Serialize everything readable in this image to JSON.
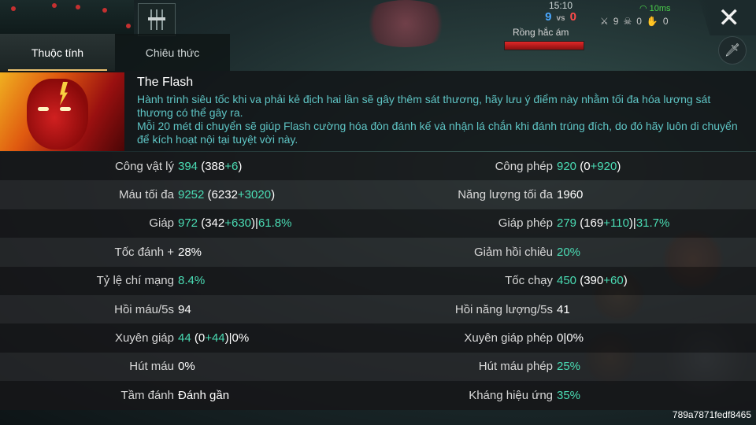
{
  "hud": {
    "time": "15:10",
    "score_blue": "9",
    "score_vs": "vs",
    "score_red": "0",
    "kills": "9",
    "deaths": "0",
    "assists": "0",
    "wifi_label": "10ms",
    "unit_label": "Rồng hắc ám",
    "close_symbol": "✕"
  },
  "tabs": [
    {
      "label": "Thuộc tính",
      "active": true
    },
    {
      "label": "Chiêu thức",
      "active": false
    }
  ],
  "hero": {
    "name": "The Flash",
    "description": [
      "Hành trình siêu tốc khi va phải kẻ địch hai lần sẽ gây thêm sát thương, hãy lưu ý điểm này nhằm tối đa hóa lượng sát thương có thể gây ra.",
      "Mỗi 20 mét di chuyển sẽ giúp Flash cường hóa đòn đánh kế và nhận lá chắn khi đánh trúng đích, do đó hãy luôn di chuyển để kích hoạt nội tại tuyệt vời này."
    ]
  },
  "stats": {
    "rows": [
      {
        "left": {
          "label": "Công vật lý",
          "value": "394",
          "detail_pre": " (388",
          "detail_bonus": "+6",
          "detail_post": ")"
        },
        "right": {
          "label": "Công phép",
          "value": "920",
          "detail_pre": " (0",
          "detail_bonus": "+920",
          "detail_post": ")"
        }
      },
      {
        "left": {
          "label": "Máu tối đa",
          "value": "9252",
          "detail_pre": " (6232",
          "detail_bonus": "+3020",
          "detail_post": ")"
        },
        "right": {
          "label": "Năng lượng tối đa",
          "value": "1960",
          "detail_pre": "",
          "detail_bonus": "",
          "detail_post": ""
        }
      },
      {
        "left": {
          "label": "Giáp",
          "value": "972",
          "detail_pre": " (342",
          "detail_bonus": "+630",
          "detail_post": ")|",
          "detail_extra": "61.8%"
        },
        "right": {
          "label": "Giáp phép",
          "value": "279",
          "detail_pre": " (169",
          "detail_bonus": "+110",
          "detail_post": ")|",
          "detail_extra": "31.7%"
        }
      },
      {
        "left": {
          "label": "Tốc đánh +",
          "value": "28%",
          "detail_pre": "",
          "detail_bonus": "",
          "detail_post": ""
        },
        "right": {
          "label": "Giảm hồi chiêu",
          "value": "20%",
          "detail_pre": "",
          "detail_bonus": "",
          "detail_post": ""
        }
      },
      {
        "left": {
          "label": "Tỷ lệ chí mạng",
          "value": "8.4%",
          "detail_pre": "",
          "detail_bonus": "",
          "detail_post": ""
        },
        "right": {
          "label": "Tốc chạy",
          "value": "450",
          "detail_pre": " (390",
          "detail_bonus": "+60",
          "detail_post": ")"
        }
      },
      {
        "left": {
          "label": "Hồi máu/5s",
          "value": "94",
          "detail_pre": "",
          "detail_bonus": "",
          "detail_post": ""
        },
        "right": {
          "label": "Hồi năng lượng/5s",
          "value": "41",
          "detail_pre": "",
          "detail_bonus": "",
          "detail_post": ""
        }
      },
      {
        "left": {
          "label": "Xuyên giáp",
          "value": "44",
          "detail_pre": " (0",
          "detail_bonus": "+44",
          "detail_post": ")|0%"
        },
        "right": {
          "label": "Xuyên giáp phép",
          "value": "0|0%",
          "detail_pre": "",
          "detail_bonus": "",
          "detail_post": ""
        }
      },
      {
        "left": {
          "label": "Hút máu",
          "value": "0%",
          "detail_pre": "",
          "detail_bonus": "",
          "detail_post": ""
        },
        "right": {
          "label": "Hút máu phép",
          "value": "25%",
          "detail_pre": "",
          "detail_bonus": "",
          "detail_post": ""
        }
      },
      {
        "left": {
          "label": "Tầm đánh",
          "value": "Đánh gần",
          "detail_pre": "",
          "detail_bonus": "",
          "detail_post": ""
        },
        "right": {
          "label": "Kháng hiệu ứng",
          "value": "35%",
          "detail_pre": "",
          "detail_bonus": "",
          "detail_post": ""
        }
      }
    ]
  },
  "footer": {
    "id": "789a7871fedf8465"
  },
  "colors": {
    "bonus": "#4adcb4",
    "description": "#5ec4c4",
    "tab_accent": "#e8c070"
  }
}
